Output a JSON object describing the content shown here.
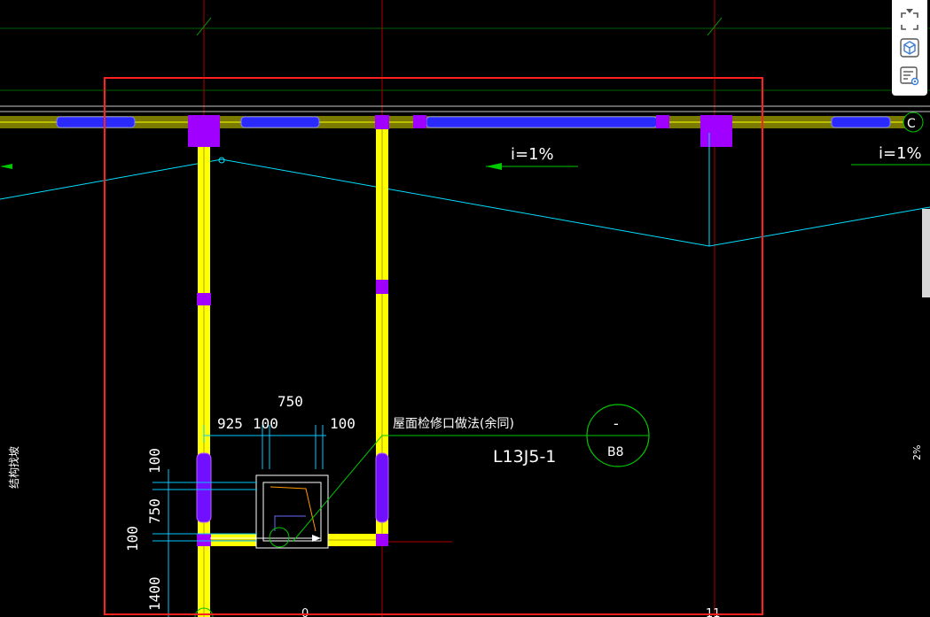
{
  "drawing": {
    "slope_left": "i=1%",
    "slope_right": "i=1%",
    "dim_top_width": "750",
    "dim_left_offset": "925",
    "dim_left_wall": "100",
    "dim_right_wall": "100",
    "dim_v_top": "100",
    "dim_v_height": "750",
    "dim_v_bottom": "100",
    "dim_v_lower": "1400",
    "leader_text": "屋面检修口做法(余同)",
    "reference_code": "L13J5-1",
    "detail_circle_top": "-",
    "detail_circle_bottom": "B8",
    "left_margin_text": "结构找坡",
    "grid_axis_label": "C",
    "right_edge_text": "2%",
    "bottom_axis_left": "0",
    "bottom_axis_right": "11"
  },
  "toolbar": {
    "icons": [
      "caret-down-icon",
      "fullscreen-icon",
      "view-cube-icon",
      "layer-list-icon"
    ]
  },
  "colors": {
    "background": "#000000",
    "wall_yellow": "#ffff00",
    "column_purple": "#a000ff",
    "window_blue": "#2020ff",
    "slope_cyan": "#00e5ff",
    "leader_green": "#00c800",
    "grid_red": "#c00000",
    "selection_red": "#ff2020"
  }
}
